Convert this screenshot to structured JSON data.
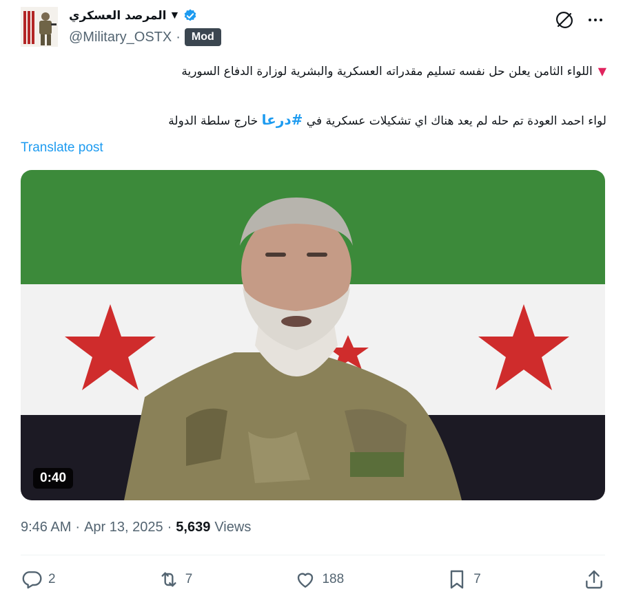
{
  "header": {
    "display_name": "المرصد العسكري",
    "name_flag": "▼",
    "handle": "@Military_OSTX",
    "separator": "·",
    "badge": "Mod",
    "avatar_icon": "military-profile-avatar",
    "verified_icon": "verified-badge-icon",
    "grok_icon": "grok-icon",
    "more_icon": "more-dots-icon",
    "verified_color": "#1d9bf0"
  },
  "post": {
    "line1_marker": "▼",
    "line1": "اللواء الثامن يعلن حل نفسه  تسليم مقدراته العسكرية والبشرية لوزارة الدفاع السورية",
    "line2_pre": "لواء احمد العودة تم حله لم يعد هناك اي تشكيلات عسكرية في ",
    "hashtag": "#درعا",
    "line2_post": " خارج سلطة الدولة",
    "translate": "Translate post",
    "hashtag_color": "#1d9bf0"
  },
  "video": {
    "duration": "0:40",
    "flag_colors": {
      "top": "#3c8a3a",
      "middle": "#f2f2f2",
      "bottom": "#1c1a24",
      "star": "#cf2c2c"
    }
  },
  "meta": {
    "time": "9:46 AM",
    "dot1": "·",
    "date": "Apr 13, 2025",
    "dot2": "·",
    "views_count": "5,639",
    "views_label": "Views"
  },
  "actions": {
    "reply": {
      "icon": "reply-icon",
      "count": "2"
    },
    "repost": {
      "icon": "repost-icon",
      "count": "7"
    },
    "like": {
      "icon": "heart-icon",
      "count": "188"
    },
    "bookmark": {
      "icon": "bookmark-icon",
      "count": "7"
    },
    "share": {
      "icon": "share-icon"
    }
  }
}
